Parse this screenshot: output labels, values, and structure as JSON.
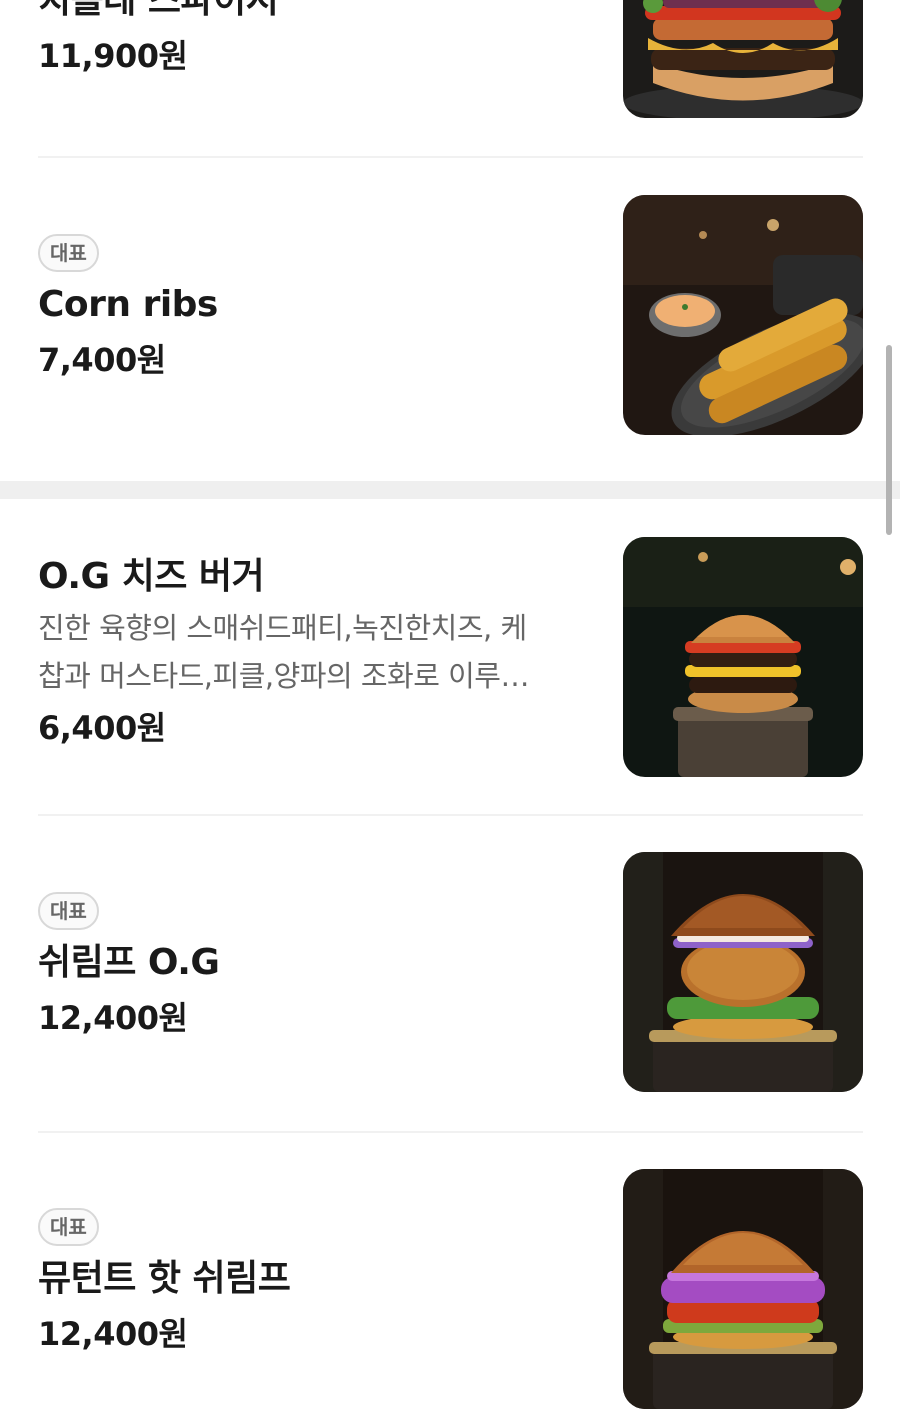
{
  "items": [
    {
      "name": "치폴레 스파이시",
      "price": "11,900원"
    },
    {
      "badge": "대표",
      "name": "Corn ribs",
      "price": "7,400원"
    },
    {
      "name": "O.G 치즈 버거",
      "description_line1": "진한 육향의 스매쉬드패티,녹진한치즈, 케",
      "description_line2": "찹과 머스타드,피클,양파의 조화로 이루…",
      "price": "6,400원"
    },
    {
      "badge": "대표",
      "name": "쉬림프 O.G",
      "price": "12,400원"
    },
    {
      "badge": "대표",
      "name": "뮤턴트 핫 쉬림프",
      "price": "12,400원"
    }
  ],
  "icons": {
    "item1": "burger-photo",
    "item2": "corn-ribs-photo",
    "item3": "cheeseburger-photo",
    "item4": "shrimp-burger-photo",
    "item5": "hot-shrimp-burger-photo"
  },
  "colors": {
    "text_primary": "#1a1a1a",
    "text_secondary": "#666666",
    "badge_border": "#d8d8d8",
    "divider": "#f1f1f1",
    "section_gap": "#efefef"
  }
}
